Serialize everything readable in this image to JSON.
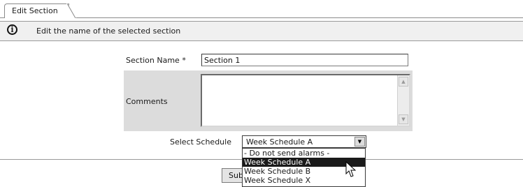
{
  "tab": {
    "label": "Edit Section"
  },
  "info": {
    "icon": "info-icon",
    "message": "Edit the name of the selected section"
  },
  "form": {
    "section_name_label": "Section Name *",
    "section_name_value": "Section 1",
    "comments_label": "Comments",
    "comments_value": "",
    "schedule_label": "Select Schedule",
    "schedule_selected": "Week Schedule A",
    "schedule_options": [
      "- Do not send alarms -",
      "Week Schedule A",
      "Week Schedule B",
      "Week Schedule X"
    ],
    "submit_label": "Sub"
  }
}
